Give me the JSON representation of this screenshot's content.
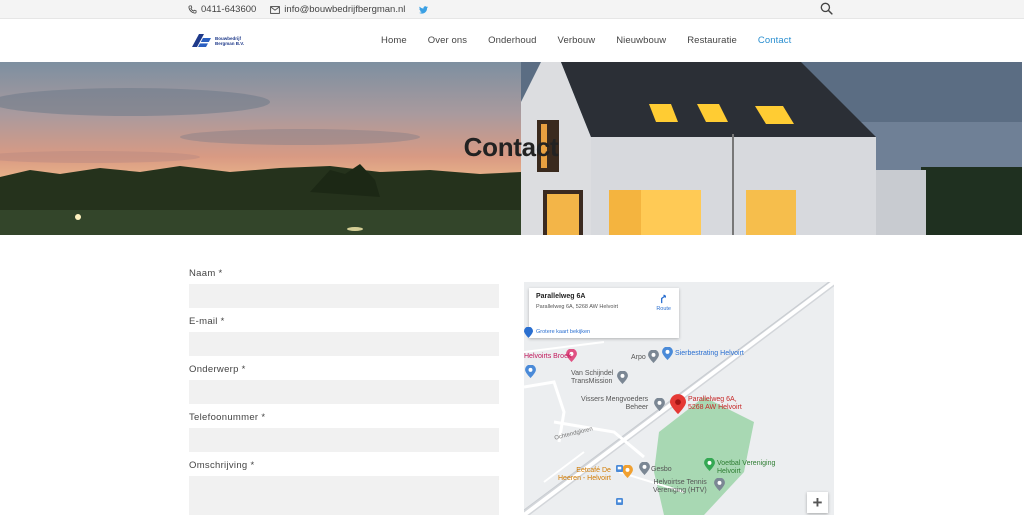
{
  "topbar": {
    "phone": "0411-643600",
    "email": "info@bouwbedrijfbergman.nl",
    "icons": [
      "phone-icon",
      "mail-icon",
      "twitter-icon",
      "search-icon"
    ]
  },
  "logo": {
    "line1": "Bouwbedrijf",
    "line2": "Bergman B.V."
  },
  "nav": [
    {
      "label": "Home"
    },
    {
      "label": "Over ons"
    },
    {
      "label": "Onderhoud"
    },
    {
      "label": "Verbouw"
    },
    {
      "label": "Nieuwbouw"
    },
    {
      "label": "Restauratie"
    },
    {
      "label": "Contact",
      "active": true
    }
  ],
  "hero": {
    "title": "Contact"
  },
  "form": {
    "fields": [
      {
        "label": "Naam *",
        "value": ""
      },
      {
        "label": "E-mail *",
        "value": ""
      },
      {
        "label": "Onderwerp *",
        "value": ""
      },
      {
        "label": "Telefoonummer *",
        "value": ""
      },
      {
        "label": "Omschrijving *",
        "value": ""
      }
    ]
  },
  "map": {
    "card": {
      "name": "Parallelweg 6A",
      "address": "Parallelweg 6A, 5268 AW Helvoirt",
      "route": "Route",
      "larger_map": "Grotere kaart bekijken"
    },
    "labels": {
      "broek": "Helvoirts Broek",
      "arpo": "Arpo",
      "sierbestrating": "Sierbestrating Helvoirt",
      "vanschijndel": "Van Schijndel\nTransMission",
      "vissers": "Vissers Mengvoeders\nBeheer",
      "marker": "Parallelweg 6A,\n5268 AW Helvoirt",
      "street": "Ochtendgloren",
      "eetcafe": "Eetcafé De\nHeeren - Helvoirt",
      "gesbo": "Gesbo",
      "voetbal": "Voetbal Vereniging\nHelvoirt",
      "tennis": "Helvoirtse Tennis\nVereniging (HTV)"
    },
    "zoom_in": "+"
  },
  "colors": {
    "accent": "#2a8fd0",
    "field_bg": "#f1f1f1",
    "marker": "#e53935"
  }
}
